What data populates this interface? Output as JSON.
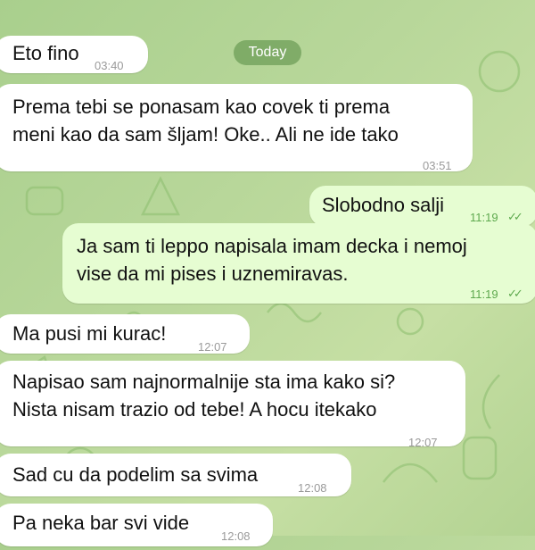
{
  "date_divider": "Today",
  "messages": [
    {
      "text": "Eto fino",
      "time": "03:40",
      "direction": "incoming"
    },
    {
      "text": "Prema tebi se ponasam kao covek ti prema\nmeni kao da sam šljam!  Oke..  Ali ne ide tako",
      "time": "03:51",
      "direction": "incoming"
    },
    {
      "text": "Slobodno salji",
      "time": "11:19",
      "direction": "outgoing",
      "status": "read-double-check"
    },
    {
      "text": "Ja sam ti leppo napisala imam decka i nemoj\nvise da mi pises i uznemiravas.",
      "time": "11:19",
      "direction": "outgoing",
      "status": "read-double-check"
    },
    {
      "text": "Ma pusi mi kurac!",
      "time": "12:07",
      "direction": "incoming"
    },
    {
      "text": "Napisao sam najnormalnije sta ima kako si?\nNista nisam trazio od tebe!  A hocu itekako",
      "time": "12:07",
      "direction": "incoming"
    },
    {
      "text": "Sad cu da podelim sa svima",
      "time": "12:08",
      "direction": "incoming"
    },
    {
      "text": "Pa neka bar svi vide",
      "time": "12:08",
      "direction": "incoming"
    }
  ],
  "colors": {
    "background": "#b8d79a",
    "incoming_bubble": "#ffffff",
    "outgoing_bubble": "#e6fdd2",
    "outgoing_meta": "#5ea94e"
  },
  "icons": {
    "read_status": "double-check-icon"
  }
}
